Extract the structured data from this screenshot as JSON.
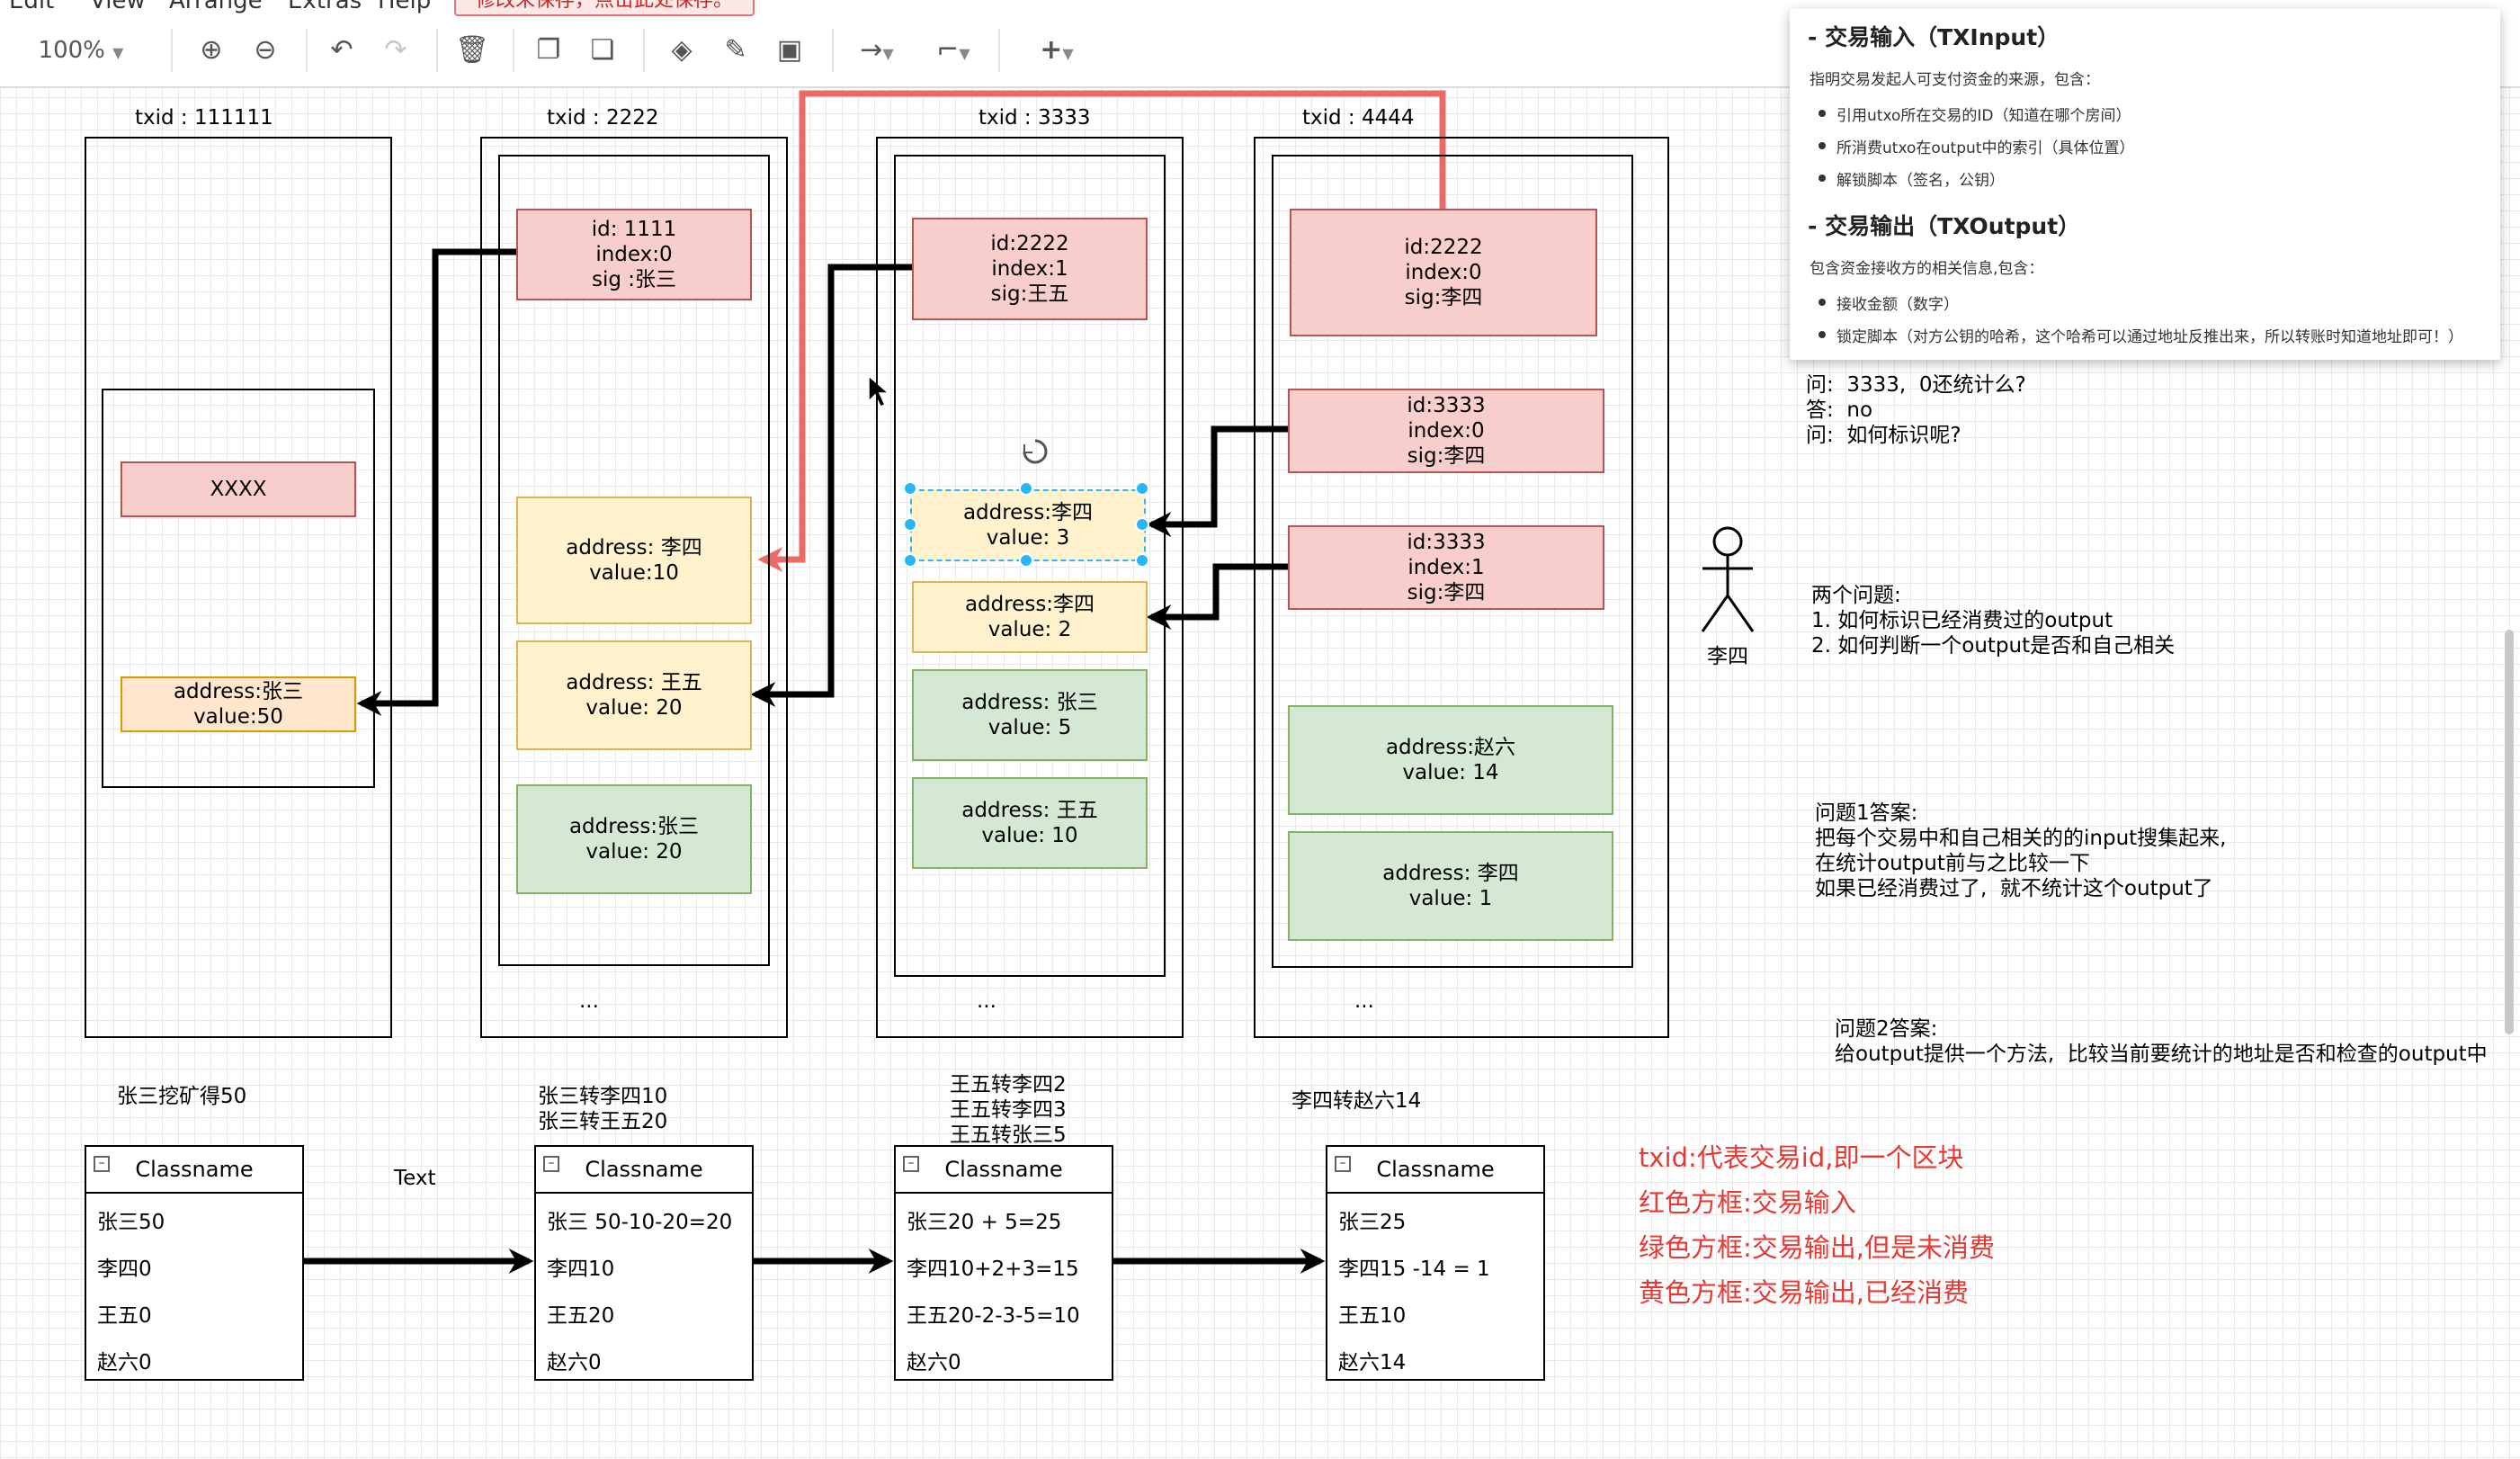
{
  "menu": {
    "items": [
      "Edit",
      "View",
      "Arrange",
      "Extras",
      "Help"
    ],
    "unsaved_banner": "修改未保存，点击此处保存。"
  },
  "toolbar": {
    "zoom": "100%",
    "icons": [
      "zoom-in-icon",
      "zoom-out-icon",
      "undo-icon",
      "redo-icon",
      "delete-icon",
      "to-front-icon",
      "to-back-icon",
      "fill-color-icon",
      "line-color-icon",
      "shadow-icon",
      "connection-icon",
      "waypoints-icon",
      "insert-icon"
    ]
  },
  "blocks": [
    {
      "title": "txid : 111111",
      "inputs": [
        "XXXX"
      ],
      "outputs": [
        {
          "lines": [
            "address:张三",
            "value:50"
          ],
          "state": "spent"
        }
      ],
      "ellipsis": ""
    },
    {
      "title": "txid : 2222",
      "inputs": [
        {
          "lines": [
            "id: 1111",
            "index:0",
            "sig :张三"
          ]
        }
      ],
      "outputs": [
        {
          "lines": [
            "address: 李四",
            "value:10"
          ],
          "state": "spent"
        },
        {
          "lines": [
            "address: 王五",
            "value: 20"
          ],
          "state": "spent"
        },
        {
          "lines": [
            "address:张三",
            "value: 20"
          ],
          "state": "unspent"
        }
      ],
      "ellipsis": "..."
    },
    {
      "title": "txid : 3333",
      "inputs": [
        {
          "lines": [
            "id:2222",
            "index:1",
            "sig:王五"
          ]
        }
      ],
      "outputs": [
        {
          "lines": [
            "address:李四",
            "value: 3"
          ],
          "state": "spent"
        },
        {
          "lines": [
            "address:李四",
            "value: 2"
          ],
          "state": "spent"
        },
        {
          "lines": [
            "address: 张三",
            "value: 5"
          ],
          "state": "unspent"
        },
        {
          "lines": [
            "address: 王五",
            "value: 10"
          ],
          "state": "unspent"
        }
      ],
      "ellipsis": "..."
    },
    {
      "title": "txid : 4444",
      "inputs": [
        {
          "lines": [
            "id:2222",
            "index:0",
            "sig:李四"
          ]
        },
        {
          "lines": [
            "id:3333",
            "index:0",
            "sig:李四"
          ]
        },
        {
          "lines": [
            "id:3333",
            "index:1",
            "sig:李四"
          ]
        }
      ],
      "outputs": [
        {
          "lines": [
            "address:赵六",
            "value: 14"
          ],
          "state": "unspent"
        },
        {
          "lines": [
            "address: 李四",
            "value: 1"
          ],
          "state": "unspent"
        }
      ],
      "ellipsis": "..."
    }
  ],
  "captions": [
    "张三挖矿得50",
    "张三转李四10\n张三转王五20",
    "王五转李四2\n王五转李四3\n王五转张三5",
    "李四转赵六14"
  ],
  "text_label": "Text",
  "classes": [
    {
      "title": "Classname",
      "rows": [
        "张三50",
        "李四0",
        "王五0",
        "赵六0"
      ]
    },
    {
      "title": "Classname",
      "rows": [
        "张三 50-10-20=20",
        "李四10",
        "王五20",
        "赵六0"
      ]
    },
    {
      "title": "Classname",
      "rows": [
        "张三20 + 5=25",
        "李四10+2+3=15",
        "王五20-2-3-5=10",
        "赵六0"
      ]
    },
    {
      "title": "Classname",
      "rows": [
        "张三25",
        "李四15 -14 = 1",
        "王五10",
        "赵六14"
      ]
    }
  ],
  "legend": [
    "txid:代表交易id,即一个区块",
    "红色方框:交易输入",
    "绿色方框:交易输出,但是未消费",
    "黄色方框:交易输出,已经消费"
  ],
  "actor_name": "李四",
  "qa": "问:  3333,  0还统计么?\n答:  no\n问:  如何标识呢?",
  "questions": "两个问题:\n1. 如何标识已经消费过的output\n2. 如何判断一个output是否和自己相关",
  "answer1": "问题1答案:\n把每个交易中和自己相关的的input搜集起来,\n在统计output前与之比较一下\n如果已经消费过了,  就不统计这个output了",
  "answer2": "问题2答案:\n给output提供一个方法,  比较当前要统计的地址是否和检查的output中",
  "panel": {
    "h1": "- 交易输入（TXInput）",
    "p1": "指明交易发起人可支付资金的来源，包含：",
    "l1": [
      "引用utxo所在交易的ID（知道在哪个房间）",
      "所消费utxo在output中的索引（具体位置）",
      "解锁脚本（签名，公钥）"
    ],
    "h2": "- 交易输出（TXOutput）",
    "p2": "包含资金接收方的相关信息,包含：",
    "l2": [
      "接收金额（数字）",
      "锁定脚本（对方公钥的哈希，这个哈希可以通过地址反推出来，所以转账时知道地址即可！）"
    ]
  },
  "colors": {
    "input_fill": "#f8cecc",
    "input_stroke": "#b85450",
    "spent_fill": "#fff2cc",
    "spent_stroke": "#d6b656",
    "unspent_fill": "#d5e8d4",
    "unspent_stroke": "#82b366",
    "legend_text": "#e53935",
    "highlight_arrow": "#ea6b66"
  }
}
